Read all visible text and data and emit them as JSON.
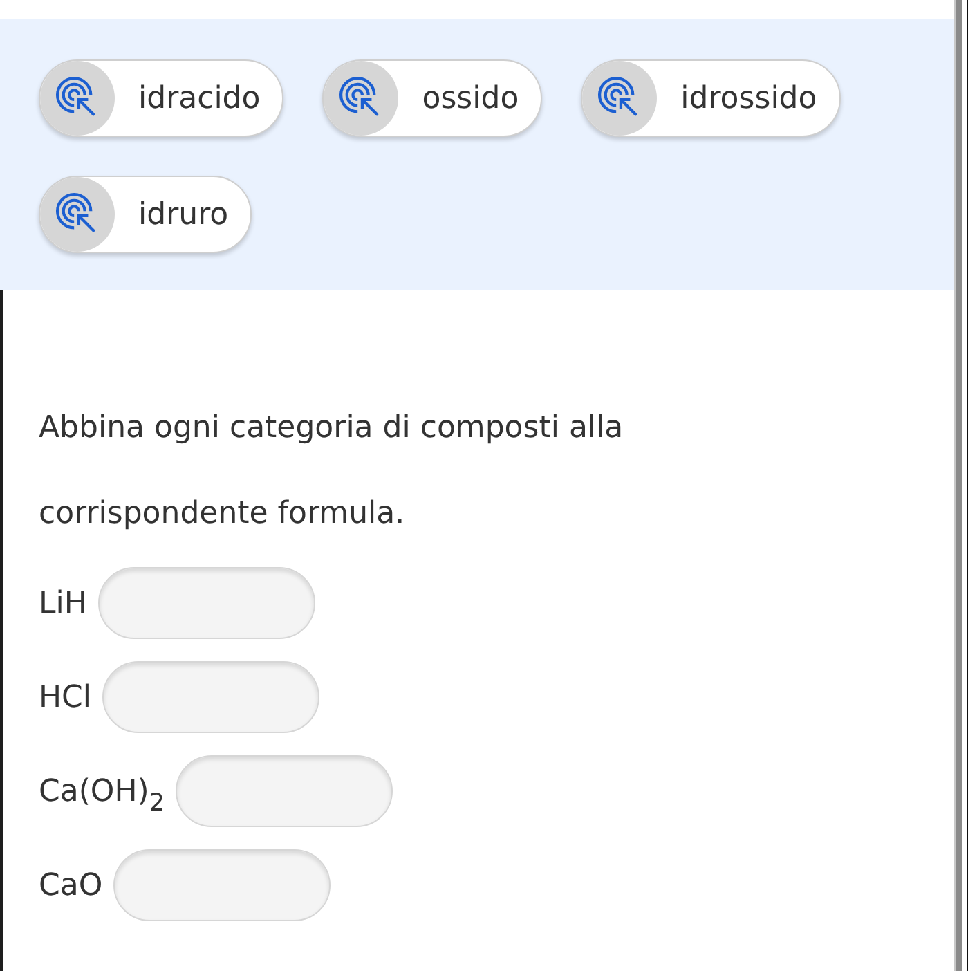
{
  "choices": [
    {
      "label": "idracido"
    },
    {
      "label": "ossido"
    },
    {
      "label": "idrossido"
    },
    {
      "label": "idruro"
    }
  ],
  "question": "Abbina ogni categoria di composti alla corrispondente formula.",
  "answers": [
    {
      "formula": "LiH"
    },
    {
      "formula": "HCl"
    },
    {
      "formula": "Ca(OH)$_{2}$"
    },
    {
      "formula": "CaO"
    }
  ]
}
